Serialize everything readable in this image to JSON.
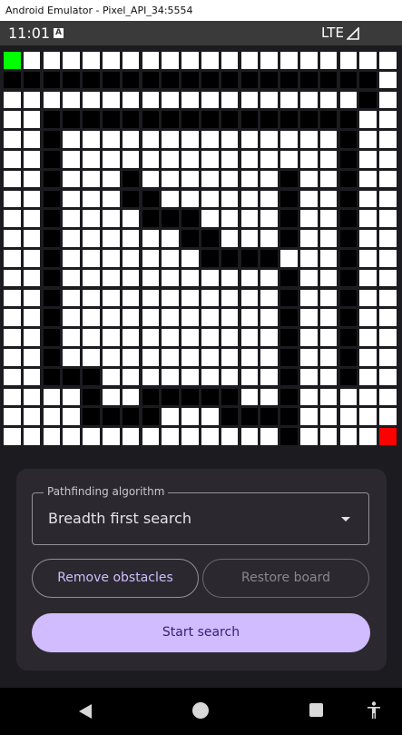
{
  "window": {
    "title": "Android Emulator - Pixel_API_34:5554"
  },
  "status_bar": {
    "time": "11:01",
    "network": "LTE"
  },
  "grid": {
    "size": 20,
    "colors": {
      "empty": "#ffffff",
      "wall": "#000000",
      "start": "#00ff00",
      "end": "#ff0000"
    },
    "start": [
      0,
      0
    ],
    "end": [
      19,
      19
    ],
    "walls": [
      "....................",
      "###################.",
      "..................#.",
      "..################..",
      "..#..............#..",
      "..#..............#..",
      "..#...#.......#..#..",
      "..#...##......#..#..",
      "..#....###....#..#..",
      "..#......##...#..#..",
      "..#.......####...#..",
      "..#...........#..#..",
      "..#...........#..#..",
      "..#...........#..#..",
      "..#...........#..#..",
      "..#...........#..#..",
      "..###.........#..#..",
      "....#..#####..#.....",
      "....####...####.....",
      "..............#....."
    ]
  },
  "controls": {
    "algorithm_label": "Pathfinding algorithm",
    "algorithm_value": "Breadth first search",
    "remove_obstacles": "Remove obstacles",
    "restore_board": "Restore board",
    "start_search": "Start search"
  }
}
